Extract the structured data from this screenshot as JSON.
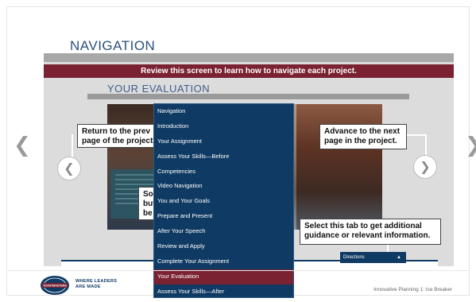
{
  "page": {
    "title": "NAVIGATION"
  },
  "slide": {
    "banner": "Review this screen to learn how to navigate each project.",
    "section_title": "YOUR EVALUATION",
    "callouts": {
      "previous_line1": "Return to the prev",
      "previous_line2": "page of the project",
      "middle_line1": "Sor",
      "middle_line2": "but",
      "middle_line3": "be",
      "next_line1": "Advance to the next",
      "next_line2": "page in the project.",
      "tab_line1": "Select this tab to get additional",
      "tab_line2": "guidance or relevant information."
    },
    "directions_tab": "Directions"
  },
  "menu": {
    "items": [
      "Navigation",
      "Introduction",
      "Your Assignment",
      "Assess Your Skills—Before",
      "Competencies",
      "Video Navigation",
      "You and Your Goals",
      "Prepare and Present",
      "After Your Speech",
      "Review and Apply",
      "Complete Your Assignment",
      "Your Evaluation",
      "Assess Your Skills—After"
    ],
    "active_item": "Your Evaluation"
  },
  "footer": {
    "logo_text": "TOASTMASTERS",
    "tagline_line1": "WHERE LEADERS",
    "tagline_line2": "ARE MADE",
    "caption": "Innovative Planning 1: Ice Breaker"
  },
  "colors": {
    "banner": "#7a2232",
    "menu_bg": "#0f3a63",
    "menu_active": "#7a2232",
    "title": "#2c4f7c"
  },
  "icons": {
    "previous": "chevron-left-icon",
    "next": "chevron-right-icon",
    "directions_caret": "caret-up-icon"
  }
}
